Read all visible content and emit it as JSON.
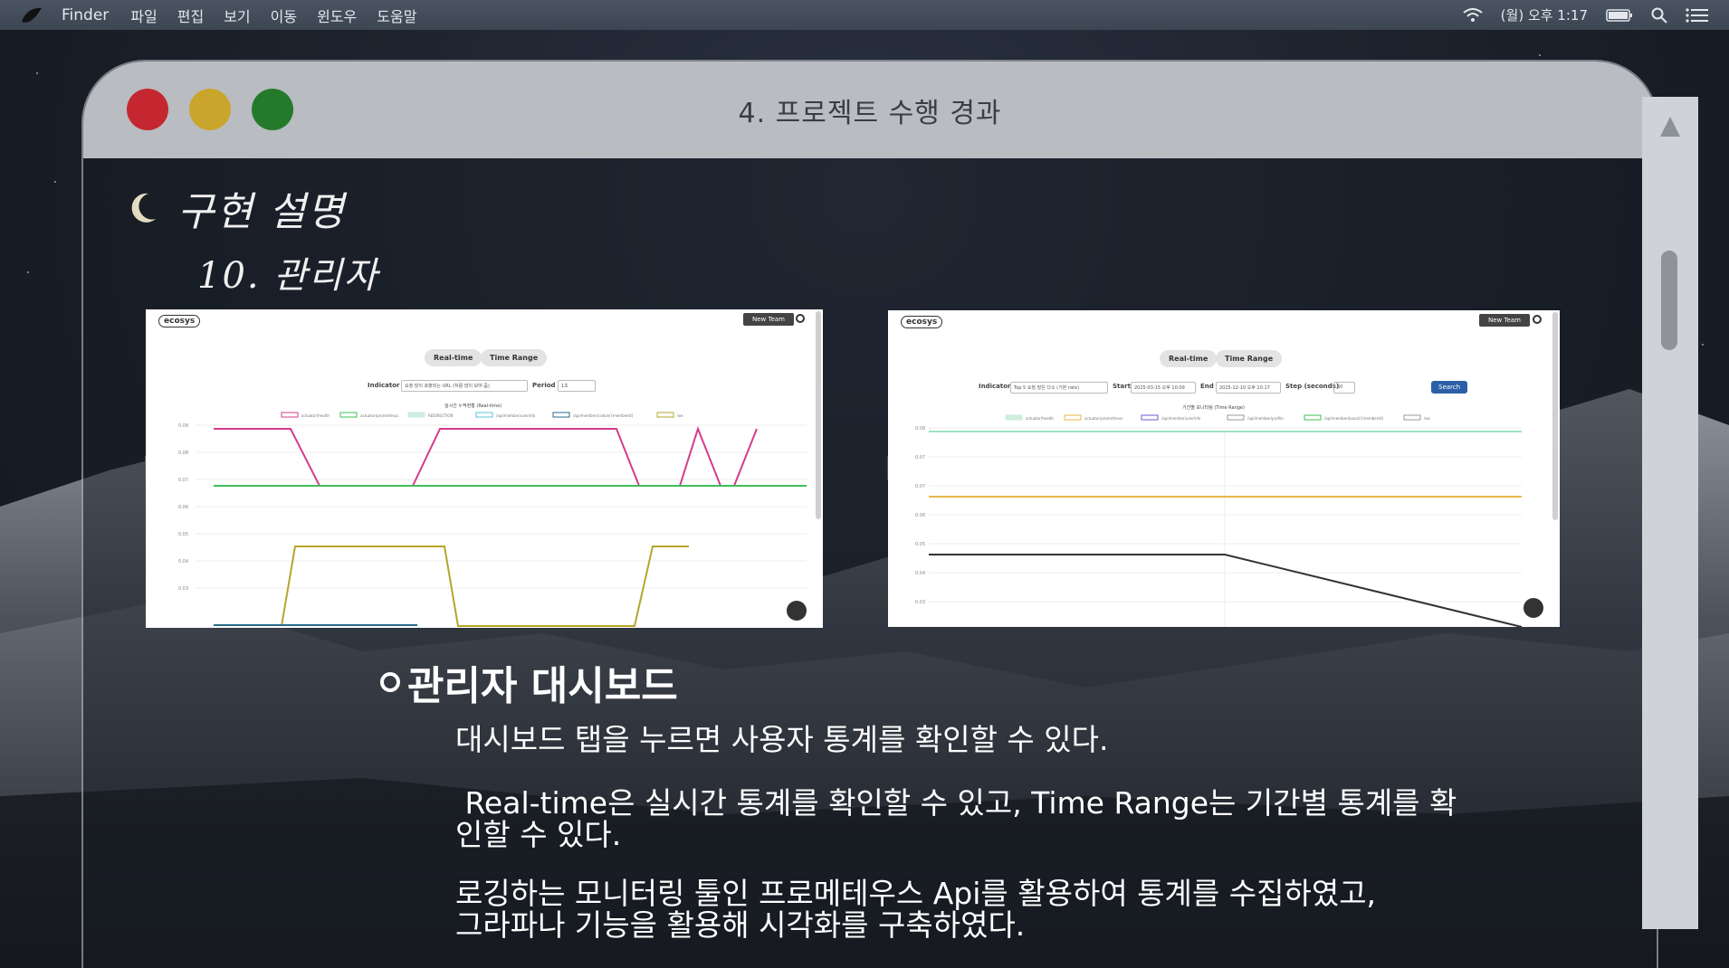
{
  "menubar": {
    "app": "Finder",
    "items": [
      "파일",
      "편집",
      "보기",
      "이동",
      "윈도우",
      "도움말"
    ],
    "clock": "(월) 오후 1:17"
  },
  "window": {
    "title": "4. 프로젝트 수행 경과"
  },
  "section": {
    "title": "구현 설명",
    "subtitle": "10. 관리자"
  },
  "shot_left": {
    "logo": "ecosys",
    "new_team": "New Team",
    "tabs": [
      "Real-time",
      "Time Range"
    ],
    "indicator_label": "Indicator",
    "indicator_value": "요청 많이 호출되는 URL (처럼 많이 보여 줌)",
    "period_label": "Period",
    "period_value": "1초",
    "chart_caption": "실시간 누적현황 (Real-time)"
  },
  "shot_right": {
    "logo": "ecosys",
    "new_team": "New Team",
    "tabs": [
      "Real-time",
      "Time Range"
    ],
    "indicator_label": "Indicator",
    "indicator_value": "Top 5 요청 많은 다소 (기본 rate)",
    "start_label": "Start",
    "start_value": "2025-03-15 오후 10:09",
    "end_label": "End",
    "end_value": "2025-12-10 오후 10:17",
    "step_label": "Step (seconds)",
    "step_value": "60",
    "search": "Search",
    "chart_caption": "기간별 모니터링 (Time Range)"
  },
  "content": {
    "heading": "관리자 대시보드",
    "para1": "대시보드 탭을 누르면 사용자 통계를 확인할 수 있다.",
    "para2_line1": " Real-time은 실시간 통계를 확인할 수 있고, Time Range는 기간별 통계를 확",
    "para2_line2": "인할 수 있다.",
    "para3_line1": "로깅하는 모니터링 툴인 프로메테우스 Api를 활용하여 통계를 수집하였고,",
    "para3_line2": "그라파나 기능을 활용해 시각화를 구축하였다."
  },
  "colors": {
    "titlebar": "#b9bcc1",
    "red": "#c4272f",
    "yellow": "#c9a52c",
    "green": "#247a2a"
  }
}
